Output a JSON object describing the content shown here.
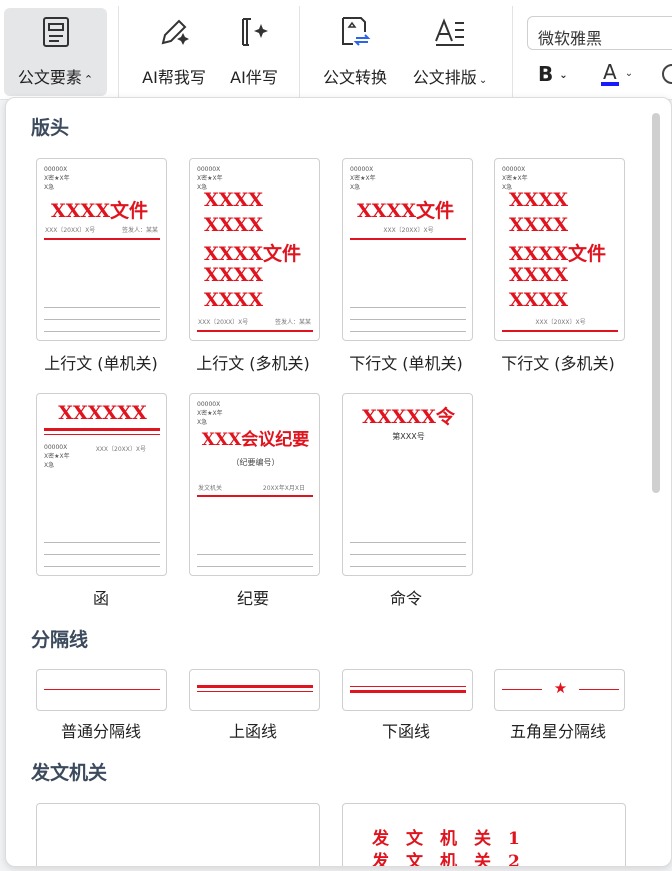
{
  "toolbar": {
    "official_elements": "公文要素",
    "ai_help_write": "AI帮我写",
    "ai_companion": "AI伴写",
    "doc_convert": "公文转换",
    "doc_layout": "公文排版",
    "font_name": "微软雅黑",
    "bold_label": "B",
    "font_color_label": "A",
    "font_color": "#1a1aff"
  },
  "sections": {
    "header": "版头",
    "divider": "分隔线",
    "issuing_org": "发文机关"
  },
  "header_cards": [
    {
      "caption": "上行文 (单机关)",
      "meta": "00000X\nX密★X年\nX急",
      "title": "XXXX文件",
      "left": "XXX〔20XX〕X号",
      "right": "签发人：某某"
    },
    {
      "caption": "上行文 (多机关)",
      "meta": "00000X\nX密★X年\nX急",
      "lines": [
        "XXXX",
        "XXXX",
        "XXXX文件",
        "XXXX",
        "XXXX"
      ],
      "left": "XXX〔20XX〕X号",
      "right": "签发人：某某"
    },
    {
      "caption": "下行文 (单机关)",
      "meta": "00000X\nX密★X年\nX急",
      "title": "XXXX文件",
      "center": "XXX〔20XX〕X号"
    },
    {
      "caption": "下行文 (多机关)",
      "meta": "00000X\nX密★X年\nX急",
      "lines": [
        "XXXX",
        "XXXX",
        "XXXX文件",
        "XXXX",
        "XXXX"
      ],
      "center": "XXX〔20XX〕X号"
    },
    {
      "caption": "函",
      "title": "XXXXXX",
      "meta": "00000X\nX密★X年\nX急",
      "right": "XXX〔20XX〕X号"
    },
    {
      "caption": "纪要",
      "meta": "00000X\nX密★X年\nX急",
      "title": "XXX会议纪要",
      "sub": "（纪要编号）",
      "left": "发文机关",
      "right": "20XX年X月X日"
    },
    {
      "caption": "命令",
      "title": "XXXXX令",
      "sub": "第XXX号"
    }
  ],
  "divider_cards": [
    {
      "caption": "普通分隔线"
    },
    {
      "caption": "上函线"
    },
    {
      "caption": "下函线"
    },
    {
      "caption": "五角星分隔线",
      "star": "★"
    }
  ],
  "org_card": {
    "lines": [
      "发　文　机　关　1",
      "发　文　机　关　2"
    ]
  }
}
